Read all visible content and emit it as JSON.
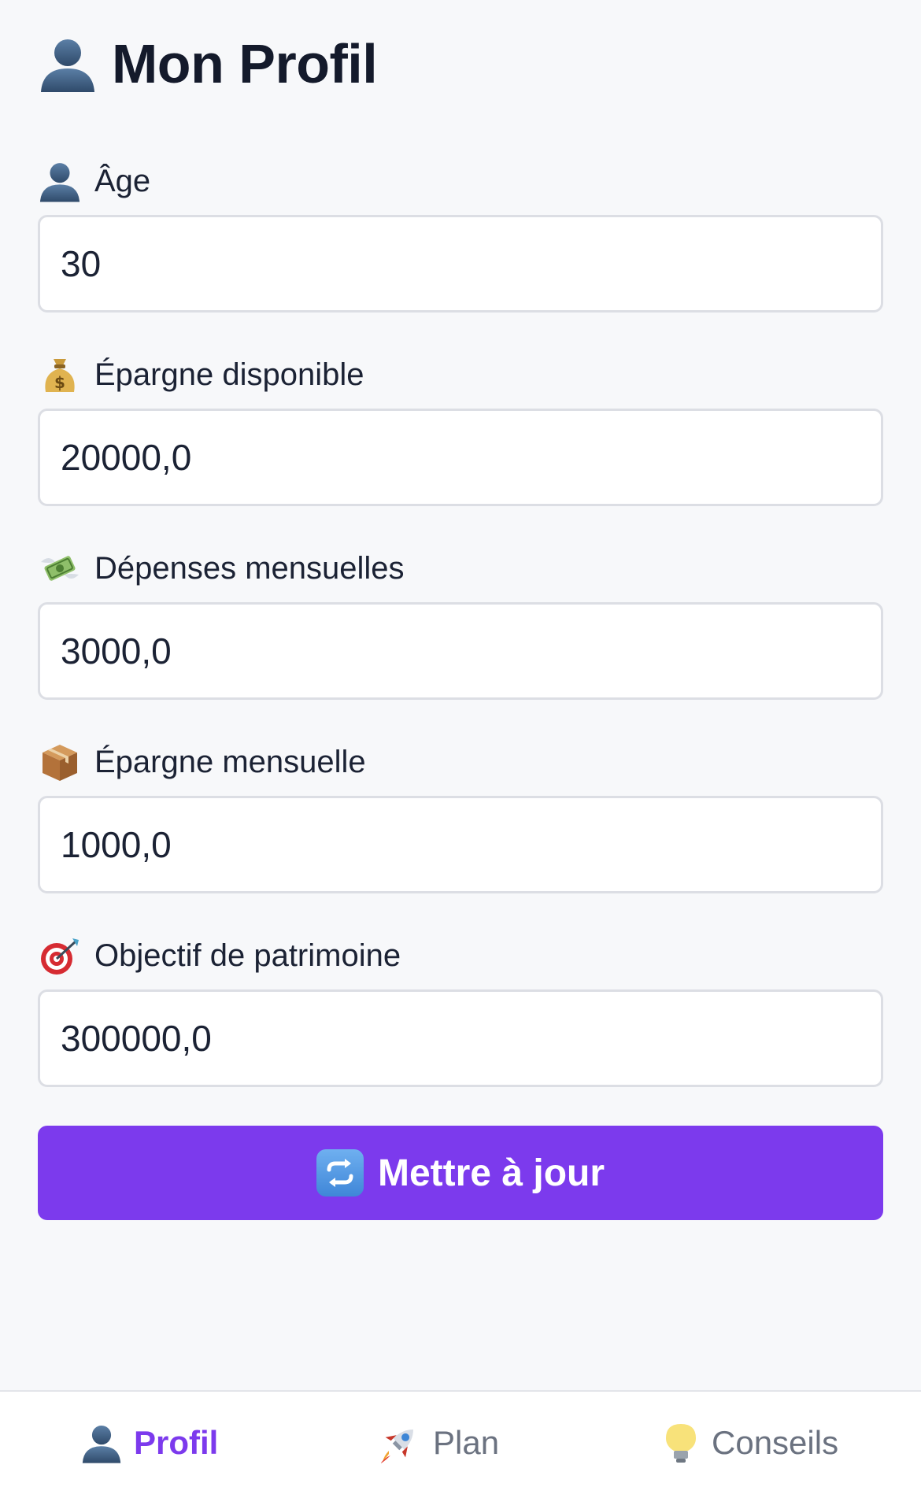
{
  "header": {
    "icon": "user-icon",
    "title": "Mon Profil"
  },
  "fields": [
    {
      "icon": "user-icon",
      "label": "Âge",
      "value": "30"
    },
    {
      "icon": "money-bag-icon",
      "label": "Épargne disponible",
      "value": "20000,0"
    },
    {
      "icon": "money-wings-icon",
      "label": "Dépenses mensuelles",
      "value": "3000,0"
    },
    {
      "icon": "package-icon",
      "label": "Épargne mensuelle",
      "value": "1000,0"
    },
    {
      "icon": "target-icon",
      "label": "Objectif de patrimoine",
      "value": "300000,0"
    }
  ],
  "update_button": {
    "icon": "refresh-icon",
    "label": "Mettre à jour"
  },
  "tabs": [
    {
      "icon": "user-icon",
      "label": "Profil",
      "active": true
    },
    {
      "icon": "rocket-icon",
      "label": "Plan",
      "active": false
    },
    {
      "icon": "lightbulb-icon",
      "label": "Conseils",
      "active": false
    }
  ],
  "colors": {
    "accent": "#7c3aed",
    "background": "#f7f8fa",
    "text": "#1b2234",
    "muted": "#6b7280"
  }
}
